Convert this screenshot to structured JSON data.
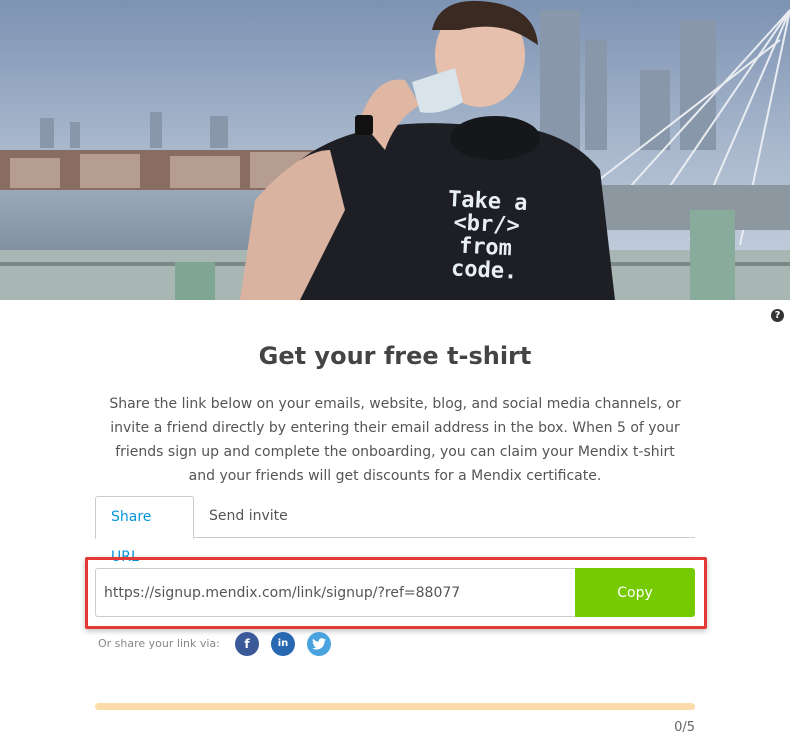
{
  "hero": {
    "shirt_lines": [
      "Take a",
      "<br/>",
      "from code."
    ]
  },
  "help": {
    "icon": "question-circle-icon",
    "glyph": "?"
  },
  "page": {
    "title": "Get your free t-shirt",
    "description": "Share the link below on your emails, website, blog, and social media channels, or invite a friend directly by entering their email address in the box. When 5 of your friends sign up and complete the onboarding, you can claim your Mendix t-shirt and your friends will get discounts for a Mendix certificate."
  },
  "tabs": [
    {
      "label": "Share URL",
      "active": true
    },
    {
      "label": "Send invite",
      "active": false
    }
  ],
  "share": {
    "url": "https://signup.mendix.com/link/signup/?ref=88077",
    "copy_label": "Copy",
    "via_label": "Or share your link via:",
    "networks": [
      {
        "name": "facebook",
        "icon": "facebook-icon",
        "glyph": "f",
        "color": "#3b5998"
      },
      {
        "name": "linkedin",
        "icon": "linkedin-icon",
        "glyph": "in",
        "color": "#2867b2"
      },
      {
        "name": "twitter",
        "icon": "twitter-icon",
        "glyph": "🐦",
        "color": "#4aa3df"
      }
    ]
  },
  "progress": {
    "count_text": "0/5",
    "current": 0,
    "target": 5,
    "track_color": "#fbdbaa"
  },
  "colors": {
    "accent_green": "#76ca02",
    "tab_active": "#0595db",
    "highlight_red": "#e53935"
  }
}
